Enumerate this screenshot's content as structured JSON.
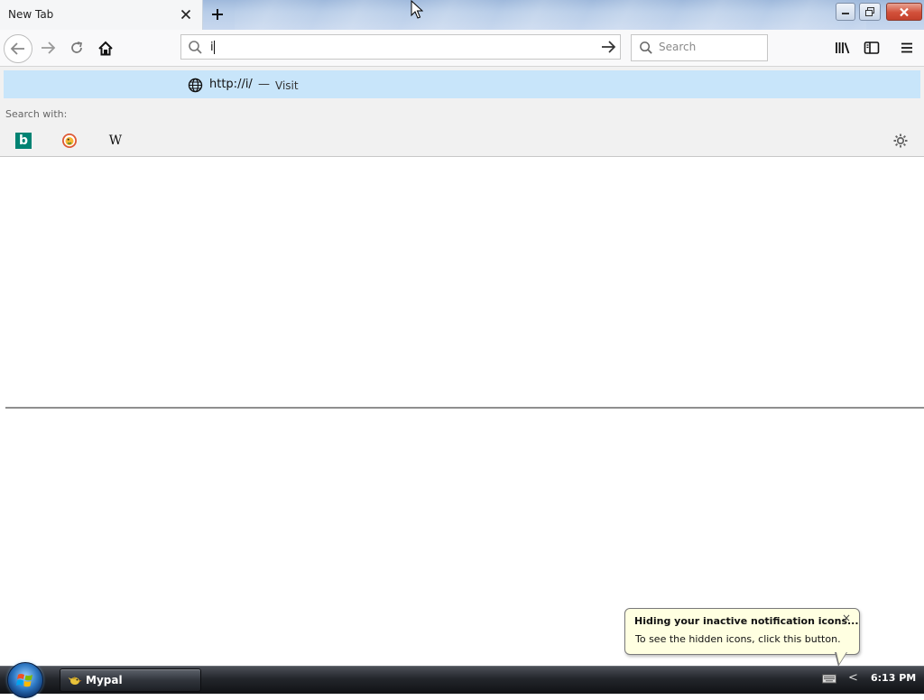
{
  "tab": {
    "title": "New Tab",
    "close_icon": "close-icon"
  },
  "toolbar": {
    "back_icon": "arrow-left-icon",
    "forward_icon": "arrow-right-icon",
    "reload_icon": "reload-icon",
    "home_icon": "home-icon",
    "library_icon": "library-icon",
    "sidebar_icon": "sidebar-icon",
    "menu_icon": "hamburger-menu-icon"
  },
  "urlbar": {
    "value": "i",
    "go_icon": "arrow-right-icon"
  },
  "searchbar": {
    "placeholder": "Search"
  },
  "popup": {
    "url": "http://i/",
    "dash": "—",
    "action": "Visit",
    "search_with_label": "Search with:",
    "engines": [
      "bing",
      "duckduckgo",
      "wikipedia"
    ],
    "wiki_glyph": "W",
    "bing_glyph": "b"
  },
  "balloon": {
    "title": "Hiding your inactive notification icons...",
    "text": "To see the hidden icons, click this button.",
    "close": "×"
  },
  "taskbar": {
    "app_label": "Mypal",
    "clock": "6:13 PM",
    "tray_chevron": "<"
  },
  "colors": {
    "popup_highlight": "#c8e5fa",
    "balloon_bg": "#ffffe1",
    "bing": "#008373"
  }
}
